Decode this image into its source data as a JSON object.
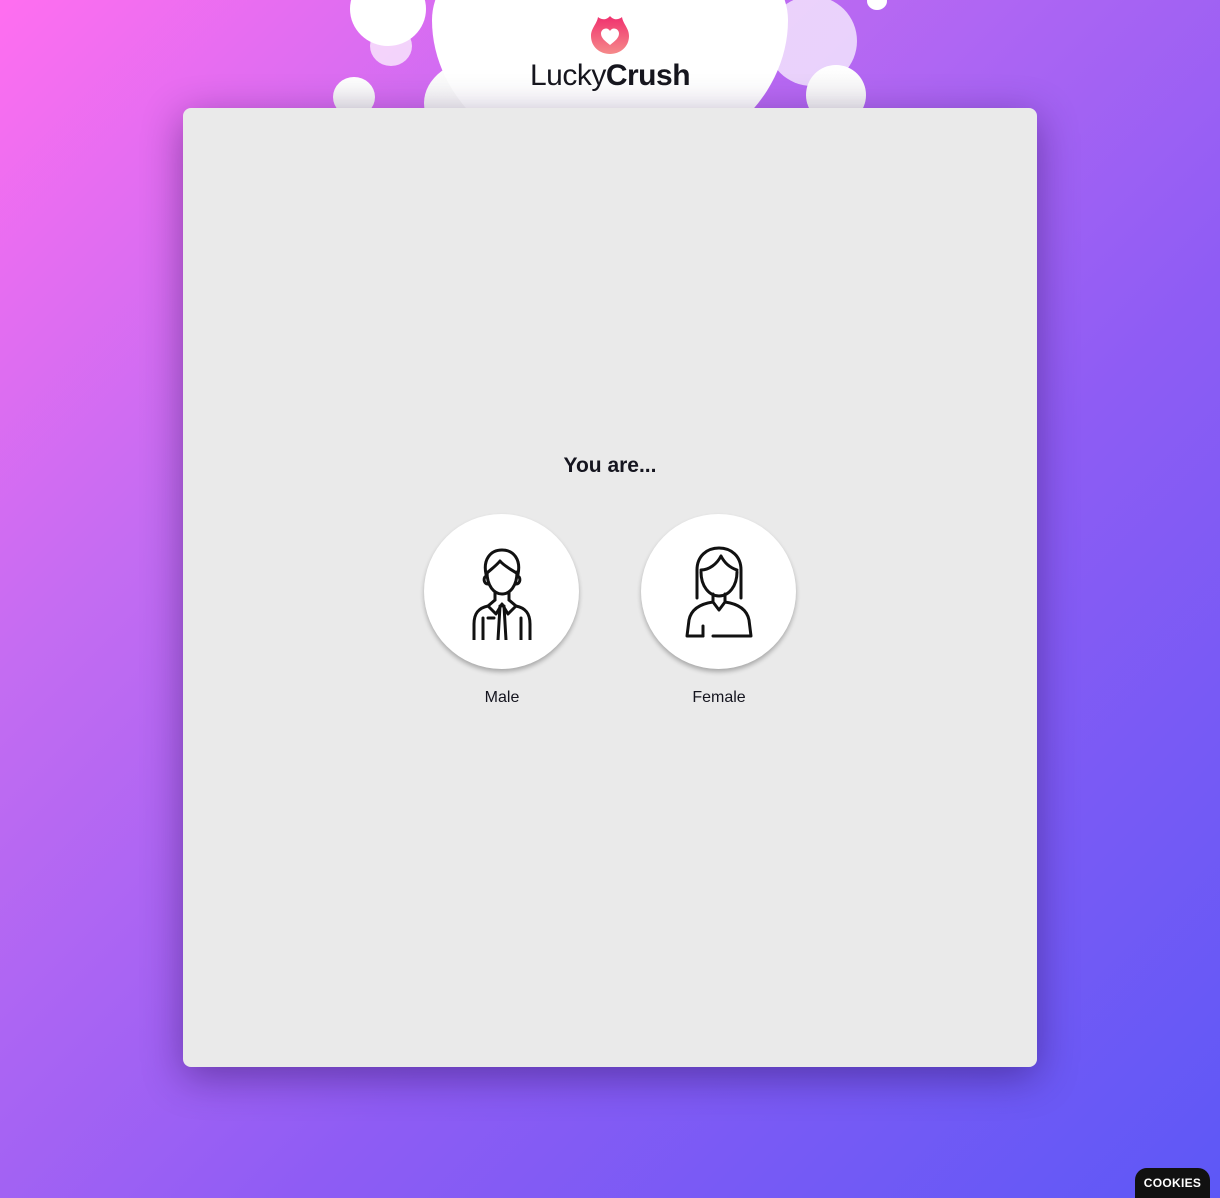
{
  "brand": {
    "name_light": "Lucky",
    "name_bold": "Crush",
    "logo_icon": "heart-flame-icon",
    "accent_color": "#f0306e"
  },
  "question": "You are...",
  "options": [
    {
      "label": "Male",
      "icon": "male-avatar-icon"
    },
    {
      "label": "Female",
      "icon": "female-avatar-icon"
    }
  ],
  "cookies": {
    "label": "COOKIES"
  }
}
